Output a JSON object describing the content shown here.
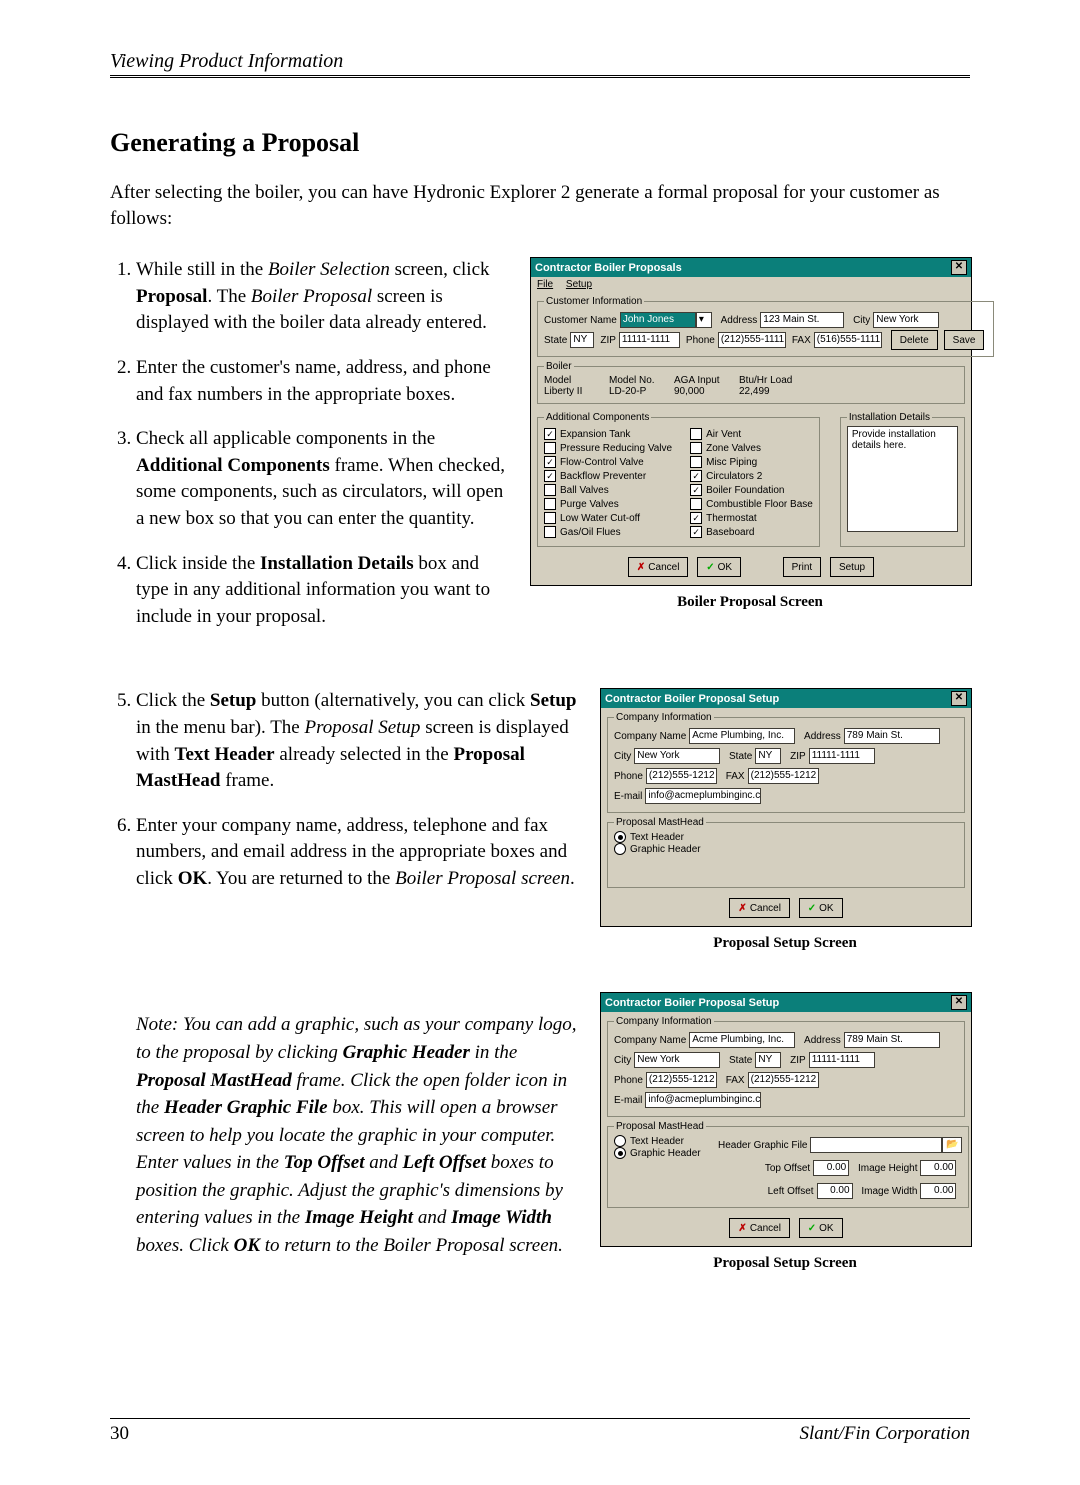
{
  "header": {
    "running_head": "Viewing Product Information"
  },
  "section": {
    "title": "Generating a Proposal"
  },
  "intro": "After selecting the boiler, you can have Hydronic Explorer 2 generate a formal proposal for your customer as follows:",
  "steps": {
    "s1_a": "While still in the ",
    "s1_b": "Boiler Selection",
    "s1_c": " screen, click ",
    "s1_d": "Proposal",
    "s1_e": ". The ",
    "s1_f": "Boiler Proposal",
    "s1_g": " screen is displayed with the boiler data already entered.",
    "s2": "Enter the customer's name, address, and phone and fax numbers in the appropriate boxes.",
    "s3_a": "Check all applicable components in the ",
    "s3_b": "Additional Components",
    "s3_c": " frame. When checked, some components, such as circulators, will open a new box so that you can enter the quantity.",
    "s4_a": "Click inside the ",
    "s4_b": "Installation Details",
    "s4_c": " box and type in any additional information you want to include in your proposal.",
    "s5_a": "Click the ",
    "s5_b": "Setup",
    "s5_c": " button (alternatively, you can click ",
    "s5_d": "Setup",
    "s5_e": " in the menu bar). The ",
    "s5_f": "Proposal Setup",
    "s5_g": " screen is displayed with ",
    "s5_h": "Text Header",
    "s5_i": " already selected in the ",
    "s5_j": "Proposal MastHead",
    "s5_k": " frame.",
    "s6_a": "Enter your company name, address, telephone and fax numbers, and email address in the appropriate boxes and click ",
    "s6_b": "OK",
    "s6_c": ". You are returned to the ",
    "s6_d": "Boiler Proposal screen",
    "s6_e": "."
  },
  "note": {
    "a": "Note: You can add a graphic, such as your company logo, to the proposal by clicking ",
    "b": "Graphic Header",
    "c": " in the ",
    "d": "Proposal MastHead",
    "e": " frame. Click the open folder icon in the ",
    "f": "Header Graphic File",
    "g": " box. This will open a browser screen to help you locate the graphic in your computer. Enter values in the ",
    "h": "Top Offset",
    "i": " and ",
    "j": "Left Offset",
    "k": " boxes to position the graphic. Adjust the graphic's dimensions by entering values in the ",
    "l": "Image Height",
    "m": " and ",
    "n": "Image Width",
    "o": " boxes. Click ",
    "p": "OK",
    "q": " to return to the Boiler Proposal screen."
  },
  "win_boiler": {
    "title": "Contractor Boiler Proposals",
    "menu_file": "File",
    "menu_setup": "Setup",
    "grp_customer": "Customer Information",
    "lbl_customer_name": "Customer Name",
    "val_customer_name": "John Jones",
    "lbl_address": "Address",
    "val_address": "123 Main St.",
    "lbl_city": "City",
    "val_city": "New York",
    "lbl_state": "State",
    "val_state": "NY",
    "lbl_zip": "ZIP",
    "val_zip": "11111-1111",
    "lbl_phone": "Phone",
    "val_phone": "(212)555-1111",
    "lbl_fax": "FAX",
    "val_fax": "(516)555-1111",
    "btn_delete": "Delete",
    "btn_save": "Save",
    "grp_boiler": "Boiler",
    "lbl_model": "Model",
    "val_model": "Liberty II",
    "lbl_model_no": "Model No.",
    "val_model_no": "LD-20-P",
    "lbl_aga": "AGA Input",
    "val_aga": "90,000",
    "lbl_heat": "Btu/Hr Load",
    "val_heat": "22,499",
    "grp_components": "Additional Components",
    "comp": {
      "exp_tank": "Expansion Tank",
      "prv": "Pressure Reducing Valve",
      "flow_control": "Flow-Control Valve",
      "backflow": "Backflow Preventer",
      "ball_valves": "Ball Valves",
      "purge_valves": "Purge Valves",
      "low_water": "Low Water Cut-off",
      "gas_oil": "Gas/Oil Flues",
      "air_vent": "Air Vent",
      "zone_valves": "Zone Valves",
      "misc_piping": "Misc Piping",
      "circulators": "Circulators",
      "circulators_qty": "2",
      "boiler_foundation": "Boiler Foundation",
      "floor_base": "Combustible Floor Base",
      "thermostat": "Thermostat",
      "baseboard": "Baseboard"
    },
    "grp_install": "Installation Details",
    "install_text": "Provide installation details here.",
    "btn_cancel": "Cancel",
    "btn_ok": "OK",
    "btn_print": "Print",
    "btn_setup": "Setup",
    "caption": "Boiler Proposal Screen"
  },
  "win_setup1": {
    "title": "Contractor Boiler Proposal Setup",
    "grp_company": "Company Information",
    "lbl_company": "Company Name",
    "val_company": "Acme Plumbing, Inc.",
    "lbl_address": "Address",
    "val_address": "789 Main St.",
    "lbl_city": "City",
    "val_city": "New York",
    "lbl_state": "State",
    "val_state": "NY",
    "lbl_zip": "ZIP",
    "val_zip": "11111-1111",
    "lbl_phone": "Phone",
    "val_phone": "(212)555-1212",
    "lbl_fax": "FAX",
    "val_fax": "(212)555-1212",
    "lbl_email": "E-mail",
    "val_email": "info@acmeplumbinginc.com",
    "grp_masthead": "Proposal MastHead",
    "opt_text": "Text Header",
    "opt_graphic": "Graphic Header",
    "btn_cancel": "Cancel",
    "btn_ok": "OK",
    "caption": "Proposal Setup Screen"
  },
  "win_setup2": {
    "title": "Contractor Boiler Proposal Setup",
    "grp_company": "Company Information",
    "lbl_company": "Company Name",
    "val_company": "Acme Plumbing, Inc.",
    "lbl_address": "Address",
    "val_address": "789 Main St.",
    "lbl_city": "City",
    "val_city": "New York",
    "lbl_state": "State",
    "val_state": "NY",
    "lbl_zip": "ZIP",
    "val_zip": "11111-1111",
    "lbl_phone": "Phone",
    "val_phone": "(212)555-1212",
    "lbl_fax": "FAX",
    "val_fax": "(212)555-1212",
    "lbl_email": "E-mail",
    "val_email": "info@acmeplumbinginc.com",
    "grp_masthead": "Proposal MastHead",
    "opt_text": "Text Header",
    "opt_graphic": "Graphic Header",
    "lbl_graphic_file": "Header Graphic File",
    "lbl_top_offset": "Top Offset",
    "val_top_offset": "0.00",
    "lbl_image_height": "Image Height",
    "val_image_height": "0.00",
    "lbl_left_offset": "Left Offset",
    "val_left_offset": "0.00",
    "lbl_image_width": "Image Width",
    "val_image_width": "0.00",
    "btn_cancel": "Cancel",
    "btn_ok": "OK",
    "caption": "Proposal Setup Screen"
  },
  "footer": {
    "page_no": "30",
    "corp": "Slant/Fin Corporation"
  }
}
